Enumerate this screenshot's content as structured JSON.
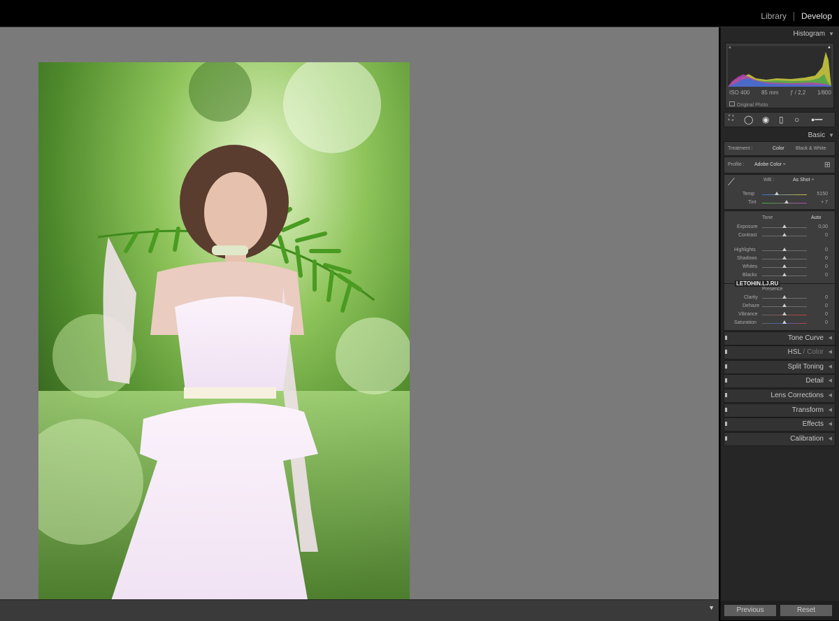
{
  "modules": {
    "library": "Library",
    "develop": "Develop"
  },
  "histogram": {
    "title": "Histogram",
    "iso": "ISO 400",
    "focal": "85 mm",
    "aperture": "ƒ / 2,2",
    "shutter": "1/800",
    "original": "Original Photo"
  },
  "basic": {
    "title": "Basic",
    "treatment_label": "Treatment :",
    "color": "Color",
    "bw": "Black & White",
    "profile_label": "Profile :",
    "profile_value": "Adobe Color ÷",
    "wb_label": "WB :",
    "wb_value": "As Shot ÷",
    "temp_label": "Temp",
    "temp_value": "5150",
    "tint_label": "Tint",
    "tint_value": "+ 7",
    "tone_label": "Tone",
    "auto": "Auto",
    "exposure_label": "Exposure",
    "exposure_value": "0,00",
    "contrast_label": "Contrast",
    "contrast_value": "0",
    "highlights_label": "Highlights",
    "highlights_value": "0",
    "shadows_label": "Shadows",
    "shadows_value": "0",
    "whites_label": "Whites",
    "whites_value": "0",
    "blacks_label": "Blacks",
    "blacks_value": "0",
    "presence_label": "Presence",
    "clarity_label": "Clarity",
    "clarity_value": "0",
    "dehaze_label": "Dehaze",
    "dehaze_value": "0",
    "vibrance_label": "Vibrance",
    "vibrance_value": "0",
    "saturation_label": "Saturation",
    "saturation_value": "0"
  },
  "watermark": "LETOHIN.LJ.RU",
  "sections": {
    "tone_curve": "Tone Curve",
    "hsl": "HSL",
    "hsl_color": "/ Color",
    "split_toning": "Split Toning",
    "detail": "Detail",
    "lens": "Lens Corrections",
    "transform": "Transform",
    "effects": "Effects",
    "calibration": "Calibration"
  },
  "buttons": {
    "previous": "Previous",
    "reset": "Reset"
  }
}
